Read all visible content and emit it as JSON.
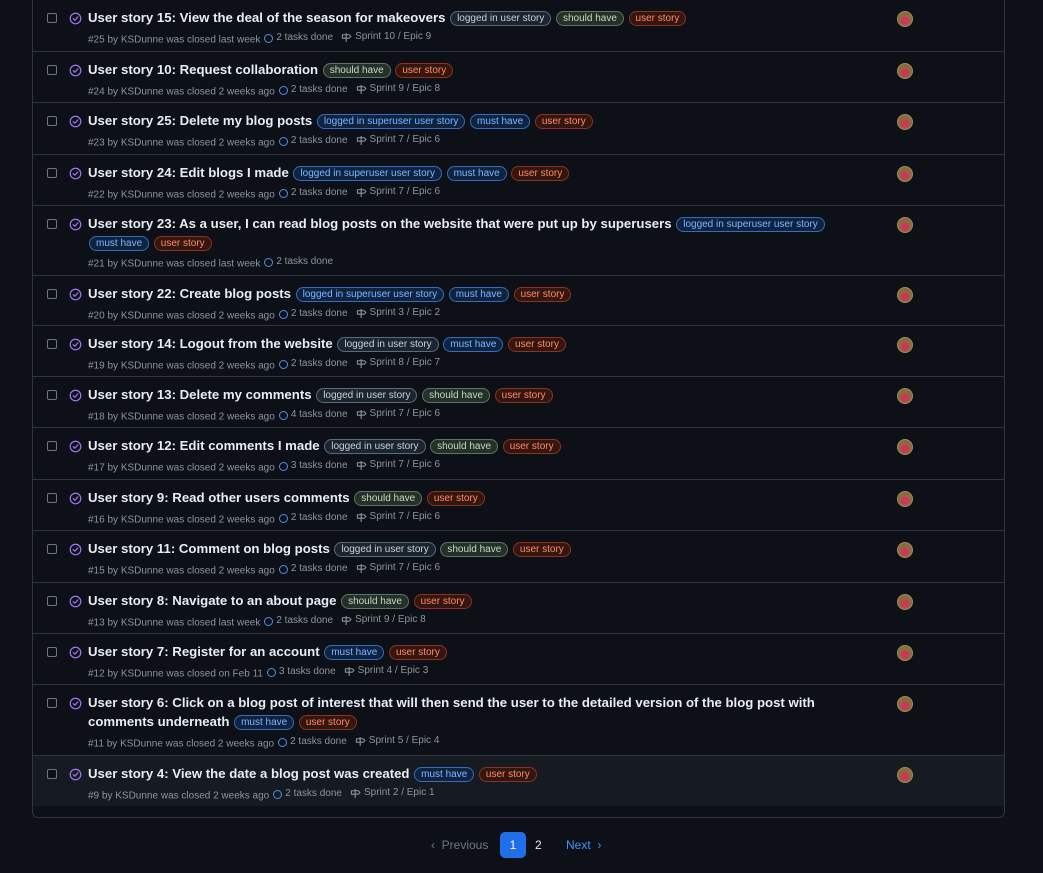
{
  "colors": {
    "background": "#0d1117",
    "border": "#30363d",
    "closed_icon": "#a371f7",
    "pagination_active": "#1f6feb",
    "link": "#4493f8"
  },
  "icons": {
    "closed_state": "issue-closed-icon",
    "tasks": "task-progress-ring-icon",
    "milestone": "milestone-signpost-icon",
    "prev": "chevron-left-icon",
    "next": "chevron-right-icon"
  },
  "issues": [
    {
      "title": "User story 15: View the deal of the season for makeovers",
      "labels": [
        {
          "text": "logged in user story",
          "kind": "logged"
        },
        {
          "text": "should have",
          "kind": "should"
        },
        {
          "text": "user story",
          "kind": "user"
        }
      ],
      "number": "#25",
      "author": "KSDunne",
      "closed": "was closed last week",
      "tasks": "2 tasks done",
      "milestone": "Sprint 10 / Epic 9"
    },
    {
      "title": "User story 10: Request collaboration",
      "labels": [
        {
          "text": "should have",
          "kind": "should"
        },
        {
          "text": "user story",
          "kind": "user"
        }
      ],
      "number": "#24",
      "author": "KSDunne",
      "closed": "was closed 2 weeks ago",
      "tasks": "2 tasks done",
      "milestone": "Sprint 9 / Epic 8"
    },
    {
      "title": "User story 25: Delete my blog posts",
      "labels": [
        {
          "text": "logged in superuser user story",
          "kind": "super"
        },
        {
          "text": "must have",
          "kind": "must"
        },
        {
          "text": "user story",
          "kind": "user"
        }
      ],
      "number": "#23",
      "author": "KSDunne",
      "closed": "was closed 2 weeks ago",
      "tasks": "2 tasks done",
      "milestone": "Sprint 7 / Epic 6"
    },
    {
      "title": "User story 24: Edit blogs I made",
      "labels": [
        {
          "text": "logged in superuser user story",
          "kind": "super"
        },
        {
          "text": "must have",
          "kind": "must"
        },
        {
          "text": "user story",
          "kind": "user"
        }
      ],
      "number": "#22",
      "author": "KSDunne",
      "closed": "was closed 2 weeks ago",
      "tasks": "2 tasks done",
      "milestone": "Sprint 7 / Epic 6"
    },
    {
      "title": "User story 23: As a user, I can read blog posts on the website that were put up by superusers",
      "labels": [
        {
          "text": "logged in superuser user story",
          "kind": "super"
        },
        {
          "text": "must have",
          "kind": "must"
        },
        {
          "text": "user story",
          "kind": "user"
        }
      ],
      "number": "#21",
      "author": "KSDunne",
      "closed": "was closed last week",
      "tasks": "2 tasks done",
      "milestone": ""
    },
    {
      "title": "User story 22: Create blog posts",
      "labels": [
        {
          "text": "logged in superuser user story",
          "kind": "super"
        },
        {
          "text": "must have",
          "kind": "must"
        },
        {
          "text": "user story",
          "kind": "user"
        }
      ],
      "number": "#20",
      "author": "KSDunne",
      "closed": "was closed 2 weeks ago",
      "tasks": "2 tasks done",
      "milestone": "Sprint 3 / Epic 2"
    },
    {
      "title": "User story 14: Logout from the website",
      "labels": [
        {
          "text": "logged in user story",
          "kind": "logged"
        },
        {
          "text": "must have",
          "kind": "must"
        },
        {
          "text": "user story",
          "kind": "user"
        }
      ],
      "number": "#19",
      "author": "KSDunne",
      "closed": "was closed 2 weeks ago",
      "tasks": "2 tasks done",
      "milestone": "Sprint 8 / Epic 7"
    },
    {
      "title": "User story 13: Delete my comments",
      "labels": [
        {
          "text": "logged in user story",
          "kind": "logged"
        },
        {
          "text": "should have",
          "kind": "should"
        },
        {
          "text": "user story",
          "kind": "user"
        }
      ],
      "number": "#18",
      "author": "KSDunne",
      "closed": "was closed 2 weeks ago",
      "tasks": "4 tasks done",
      "milestone": "Sprint 7 / Epic 6"
    },
    {
      "title": "User story 12: Edit comments I made",
      "labels": [
        {
          "text": "logged in user story",
          "kind": "logged"
        },
        {
          "text": "should have",
          "kind": "should"
        },
        {
          "text": "user story",
          "kind": "user"
        }
      ],
      "number": "#17",
      "author": "KSDunne",
      "closed": "was closed 2 weeks ago",
      "tasks": "3 tasks done",
      "milestone": "Sprint 7 / Epic 6"
    },
    {
      "title": "User story 9: Read other users comments",
      "labels": [
        {
          "text": "should have",
          "kind": "should"
        },
        {
          "text": "user story",
          "kind": "user"
        }
      ],
      "number": "#16",
      "author": "KSDunne",
      "closed": "was closed 2 weeks ago",
      "tasks": "2 tasks done",
      "milestone": "Sprint 7 / Epic 6"
    },
    {
      "title": "User story 11: Comment on blog posts",
      "labels": [
        {
          "text": "logged in user story",
          "kind": "logged"
        },
        {
          "text": "should have",
          "kind": "should"
        },
        {
          "text": "user story",
          "kind": "user"
        }
      ],
      "number": "#15",
      "author": "KSDunne",
      "closed": "was closed 2 weeks ago",
      "tasks": "2 tasks done",
      "milestone": "Sprint 7 / Epic 6"
    },
    {
      "title": "User story 8: Navigate to an about page",
      "labels": [
        {
          "text": "should have",
          "kind": "should"
        },
        {
          "text": "user story",
          "kind": "user"
        }
      ],
      "number": "#13",
      "author": "KSDunne",
      "closed": "was closed last week",
      "tasks": "2 tasks done",
      "milestone": "Sprint 9 / Epic 8"
    },
    {
      "title": "User story 7: Register for an account",
      "labels": [
        {
          "text": "must have",
          "kind": "must"
        },
        {
          "text": "user story",
          "kind": "user"
        }
      ],
      "number": "#12",
      "author": "KSDunne",
      "closed": "was closed on Feb 11",
      "tasks": "3 tasks done",
      "milestone": "Sprint 4 / Epic 3"
    },
    {
      "title": "User story 6: Click on a blog post of interest that will then send the user to the detailed version of the blog post with comments underneath",
      "labels": [
        {
          "text": "must have",
          "kind": "must"
        },
        {
          "text": "user story",
          "kind": "user"
        }
      ],
      "number": "#11",
      "author": "KSDunne",
      "closed": "was closed 2 weeks ago",
      "tasks": "2 tasks done",
      "milestone": "Sprint 5 / Epic 4"
    },
    {
      "title": "User story 4: View the date a blog post was created",
      "labels": [
        {
          "text": "must have",
          "kind": "must"
        },
        {
          "text": "user story",
          "kind": "user"
        }
      ],
      "number": "#9",
      "author": "KSDunne",
      "closed": "was closed 2 weeks ago",
      "tasks": "2 tasks done",
      "milestone": "Sprint 2 / Epic 1"
    }
  ],
  "pagination": {
    "previous": "Previous",
    "pages": [
      "1",
      "2"
    ],
    "current": "1",
    "next": "Next"
  }
}
